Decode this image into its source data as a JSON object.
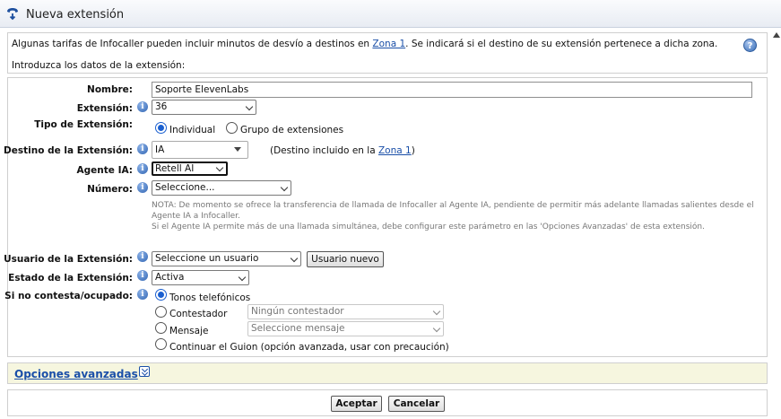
{
  "window": {
    "title": "Nueva extensión"
  },
  "intro": {
    "text_before": "Algunas tarifas de Infocaller pueden incluir minutos de desvío a destinos en ",
    "zone_link": "Zona 1",
    "text_after": ". Se indicará si el destino de su extensión pertenece a dicha zona.",
    "instruction": "Introduzca los datos de la extensión:",
    "help_glyph": "?"
  },
  "form": {
    "info_glyph": "i",
    "nombre": {
      "label": "Nombre:",
      "value": "Soporte ElevenLabs"
    },
    "extension": {
      "label": "Extensión:",
      "value": "36"
    },
    "tipo": {
      "label": "Tipo de Extensión:",
      "option_individual": "Individual",
      "option_grupo": "Grupo de extensiones",
      "selected": "Individual"
    },
    "destino": {
      "label": "Destino de la Extensión:",
      "value": "IA",
      "note_before": "(Destino incluido en la ",
      "note_link": "Zona 1",
      "note_after": ")"
    },
    "agente": {
      "label": "Agente IA:",
      "value": "Retell AI"
    },
    "numero": {
      "label": "Número:",
      "value": "Seleccione...",
      "note_line1": "NOTA: De momento se ofrece la transferencia de llamada de Infocaller al Agente IA, pendiente de permitir más adelante llamadas salientes desde el",
      "note_line2": "Agente IA a Infocaller.",
      "note_line3": "Si el Agente IA permite más de una llamada simultánea, debe configurar este parámetro en las 'Opciones Avanzadas' de esta extensión."
    },
    "usuario": {
      "label": "Usuario de la Extensión:",
      "value": "Seleccione un usuario",
      "new_button": "Usuario nuevo"
    },
    "estado": {
      "label": "Estado de la Extensión:",
      "value": "Activa"
    },
    "no_contesta": {
      "label": "Si no contesta/ocupado:",
      "option_tonos": "Tonos telefónicos",
      "option_contestador": "Contestador",
      "contestador_value": "Ningún contestador",
      "option_mensaje": "Mensaje",
      "mensaje_value": "Seleccione mensaje",
      "option_guion": "Continuar el Guion (opción avanzada, usar con precaución)",
      "selected": "Tonos telefónicos"
    }
  },
  "advanced": {
    "label": "Opciones avanzadas"
  },
  "buttons": {
    "accept": "Aceptar",
    "cancel": "Cancelar"
  },
  "colors": {
    "link": "#1a4fa8",
    "advanced_bg": "#f6f6df",
    "radio_selected": "#1a5fd0"
  }
}
